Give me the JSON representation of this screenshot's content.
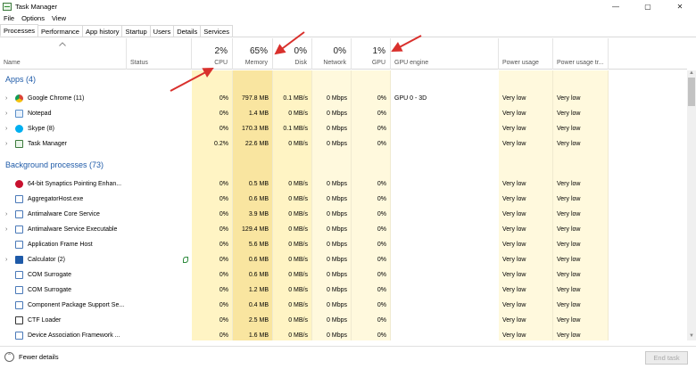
{
  "window": {
    "title": "Task Manager",
    "controls": [
      "—",
      "▢",
      "✕"
    ]
  },
  "menu": [
    "File",
    "Options",
    "View"
  ],
  "tabs": [
    "Processes",
    "Performance",
    "App history",
    "Startup",
    "Users",
    "Details",
    "Services"
  ],
  "active_tab": "Processes",
  "columns": {
    "name": "Name",
    "status": "Status",
    "cpu": {
      "pct": "2%",
      "label": "CPU"
    },
    "memory": {
      "pct": "65%",
      "label": "Memory"
    },
    "disk": {
      "pct": "0%",
      "label": "Disk"
    },
    "network": {
      "pct": "0%",
      "label": "Network"
    },
    "gpu": {
      "pct": "1%",
      "label": "GPU"
    },
    "gpu_engine": "GPU engine",
    "power_usage": "Power usage",
    "power_trend": "Power usage tr..."
  },
  "groups": {
    "apps": "Apps (4)",
    "background": "Background processes (73)"
  },
  "apps": [
    {
      "name": "Google Chrome (11)",
      "icon": "chrome-icon",
      "expand": true,
      "cpu": "0%",
      "memory": "797.8 MB",
      "disk": "0.1 MB/s",
      "network": "0 Mbps",
      "gpu": "0%",
      "gpu_engine": "GPU 0 - 3D",
      "power": "Very low",
      "power_trend": "Very low"
    },
    {
      "name": "Notepad",
      "icon": "notepad-icon",
      "expand": true,
      "cpu": "0%",
      "memory": "1.4 MB",
      "disk": "0 MB/s",
      "network": "0 Mbps",
      "gpu": "0%",
      "gpu_engine": "",
      "power": "Very low",
      "power_trend": "Very low"
    },
    {
      "name": "Skype (8)",
      "icon": "skype-icon",
      "expand": true,
      "cpu": "0%",
      "memory": "170.3 MB",
      "disk": "0.1 MB/s",
      "network": "0 Mbps",
      "gpu": "0%",
      "gpu_engine": "",
      "power": "Very low",
      "power_trend": "Very low"
    },
    {
      "name": "Task Manager",
      "icon": "task-manager-icon",
      "expand": true,
      "cpu": "0.2%",
      "memory": "22.6 MB",
      "disk": "0 MB/s",
      "network": "0 Mbps",
      "gpu": "0%",
      "gpu_engine": "",
      "power": "Very low",
      "power_trend": "Very low"
    }
  ],
  "background": [
    {
      "name": "64-bit Synaptics Pointing Enhan...",
      "icon": "synaptics-icon",
      "expand": false,
      "cpu": "0%",
      "memory": "0.5 MB",
      "disk": "0 MB/s",
      "network": "0 Mbps",
      "gpu": "0%",
      "power": "Very low",
      "power_trend": "Very low"
    },
    {
      "name": "AggregatorHost.exe",
      "icon": "process-icon",
      "expand": false,
      "cpu": "0%",
      "memory": "0.6 MB",
      "disk": "0 MB/s",
      "network": "0 Mbps",
      "gpu": "0%",
      "power": "Very low",
      "power_trend": "Very low"
    },
    {
      "name": "Antimalware Core Service",
      "icon": "process-icon",
      "expand": true,
      "cpu": "0%",
      "memory": "3.9 MB",
      "disk": "0 MB/s",
      "network": "0 Mbps",
      "gpu": "0%",
      "power": "Very low",
      "power_trend": "Very low"
    },
    {
      "name": "Antimalware Service Executable",
      "icon": "process-icon",
      "expand": true,
      "cpu": "0%",
      "memory": "129.4 MB",
      "disk": "0 MB/s",
      "network": "0 Mbps",
      "gpu": "0%",
      "power": "Very low",
      "power_trend": "Very low"
    },
    {
      "name": "Application Frame Host",
      "icon": "process-icon",
      "expand": false,
      "cpu": "0%",
      "memory": "5.6 MB",
      "disk": "0 MB/s",
      "network": "0 Mbps",
      "gpu": "0%",
      "power": "Very low",
      "power_trend": "Very low"
    },
    {
      "name": "Calculator (2)",
      "icon": "calculator-icon",
      "expand": true,
      "status_icon": true,
      "cpu": "0%",
      "memory": "0.6 MB",
      "disk": "0 MB/s",
      "network": "0 Mbps",
      "gpu": "0%",
      "power": "Very low",
      "power_trend": "Very low"
    },
    {
      "name": "COM Surrogate",
      "icon": "process-icon",
      "expand": false,
      "cpu": "0%",
      "memory": "0.6 MB",
      "disk": "0 MB/s",
      "network": "0 Mbps",
      "gpu": "0%",
      "power": "Very low",
      "power_trend": "Very low"
    },
    {
      "name": "COM Surrogate",
      "icon": "process-icon",
      "expand": false,
      "cpu": "0%",
      "memory": "1.2 MB",
      "disk": "0 MB/s",
      "network": "0 Mbps",
      "gpu": "0%",
      "power": "Very low",
      "power_trend": "Very low"
    },
    {
      "name": "Component Package Support Se...",
      "icon": "process-icon",
      "expand": false,
      "cpu": "0%",
      "memory": "0.4 MB",
      "disk": "0 MB/s",
      "network": "0 Mbps",
      "gpu": "0%",
      "power": "Very low",
      "power_trend": "Very low"
    },
    {
      "name": "CTF Loader",
      "icon": "ctf-loader-icon",
      "expand": false,
      "cpu": "0%",
      "memory": "2.5 MB",
      "disk": "0 MB/s",
      "network": "0 Mbps",
      "gpu": "0%",
      "power": "Very low",
      "power_trend": "Very low"
    },
    {
      "name": "Device Association Framework ...",
      "icon": "process-icon",
      "expand": false,
      "cpu": "0%",
      "memory": "1.6 MB",
      "disk": "0 MB/s",
      "network": "0 Mbps",
      "gpu": "0%",
      "power": "Very low",
      "power_trend": "Very low"
    }
  ],
  "footer": {
    "fewer_details": "Fewer details",
    "end_task": "End task"
  },
  "colors": {
    "heat_light": "#fff9dd",
    "heat_mid": "#fff4c4",
    "heat_strong": "#f9e5a0",
    "group_title": "#1e5aa8",
    "annotation_arrow": "#d9302c"
  }
}
